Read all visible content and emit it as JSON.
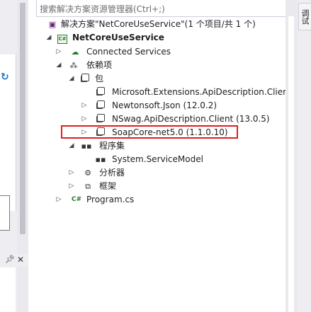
{
  "search": {
    "placeholder": "搜索解决方案资源管理器(Ctrl+;)"
  },
  "right_tab": {
    "label": "调试"
  },
  "tree": {
    "solution": "解决方案\"NetCoreUseService\"(1 个项目/共 1 个)",
    "project": "NetCoreUseService",
    "connected_services": "Connected Services",
    "dependencies": "依赖项",
    "packages": "包",
    "package_items": [
      "Microsoft.Extensions.ApiDescription.Client (",
      "Newtonsoft.Json (12.0.2)",
      "NSwag.ApiDescription.Client (13.0.5)",
      "SoapCore-net5.0 (1.1.0.10)"
    ],
    "assemblies": "程序集",
    "assembly_item": "System.ServiceModel",
    "analyzers": "分析器",
    "frameworks": "框架",
    "program_file": "Program.cs"
  },
  "icons": {
    "cs": "C#",
    "pin": "pin-icon",
    "close": "close-icon"
  },
  "colors": {
    "highlight": "#e01e1e",
    "accent": "#1b73c4"
  }
}
